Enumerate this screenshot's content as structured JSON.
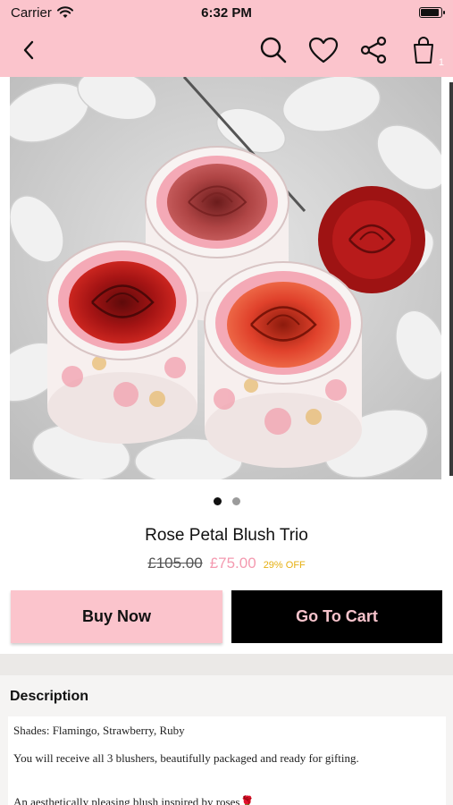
{
  "status_bar": {
    "carrier": "Carrier",
    "time": "6:32 PM"
  },
  "nav": {
    "icons": [
      "back-chevron-icon",
      "search-icon",
      "heart-icon",
      "share-icon",
      "shopping-bag-icon"
    ],
    "cart_count": "1"
  },
  "gallery": {
    "image_subject": "three round pink-lined floral pots each holding a red rose blush, one extra red rose beside them, on a white paper-flower background",
    "page_count": 2,
    "active_page": 1
  },
  "product": {
    "name": "Rose Petal Blush Trio",
    "old_price": "£105.00",
    "new_price": "£75.00",
    "discount": "29% OFF"
  },
  "actions": {
    "buy_now": "Buy Now",
    "go_to_cart": "Go To Cart"
  },
  "description": {
    "title": "Description",
    "lines": [
      "Shades: Flamingo, Strawberry, Ruby",
      "You will receive all 3 blushers, beautifully packaged and ready for gifting.",
      "An aesthetically pleasing blush inspired by roses🌹"
    ]
  },
  "colors": {
    "header_pink": "#fbc4cc",
    "price_pink": "#f49ab0",
    "discount_yellow": "#e6b012",
    "cart_button_bg": "#000000",
    "cart_button_text": "#f6c3cb"
  }
}
